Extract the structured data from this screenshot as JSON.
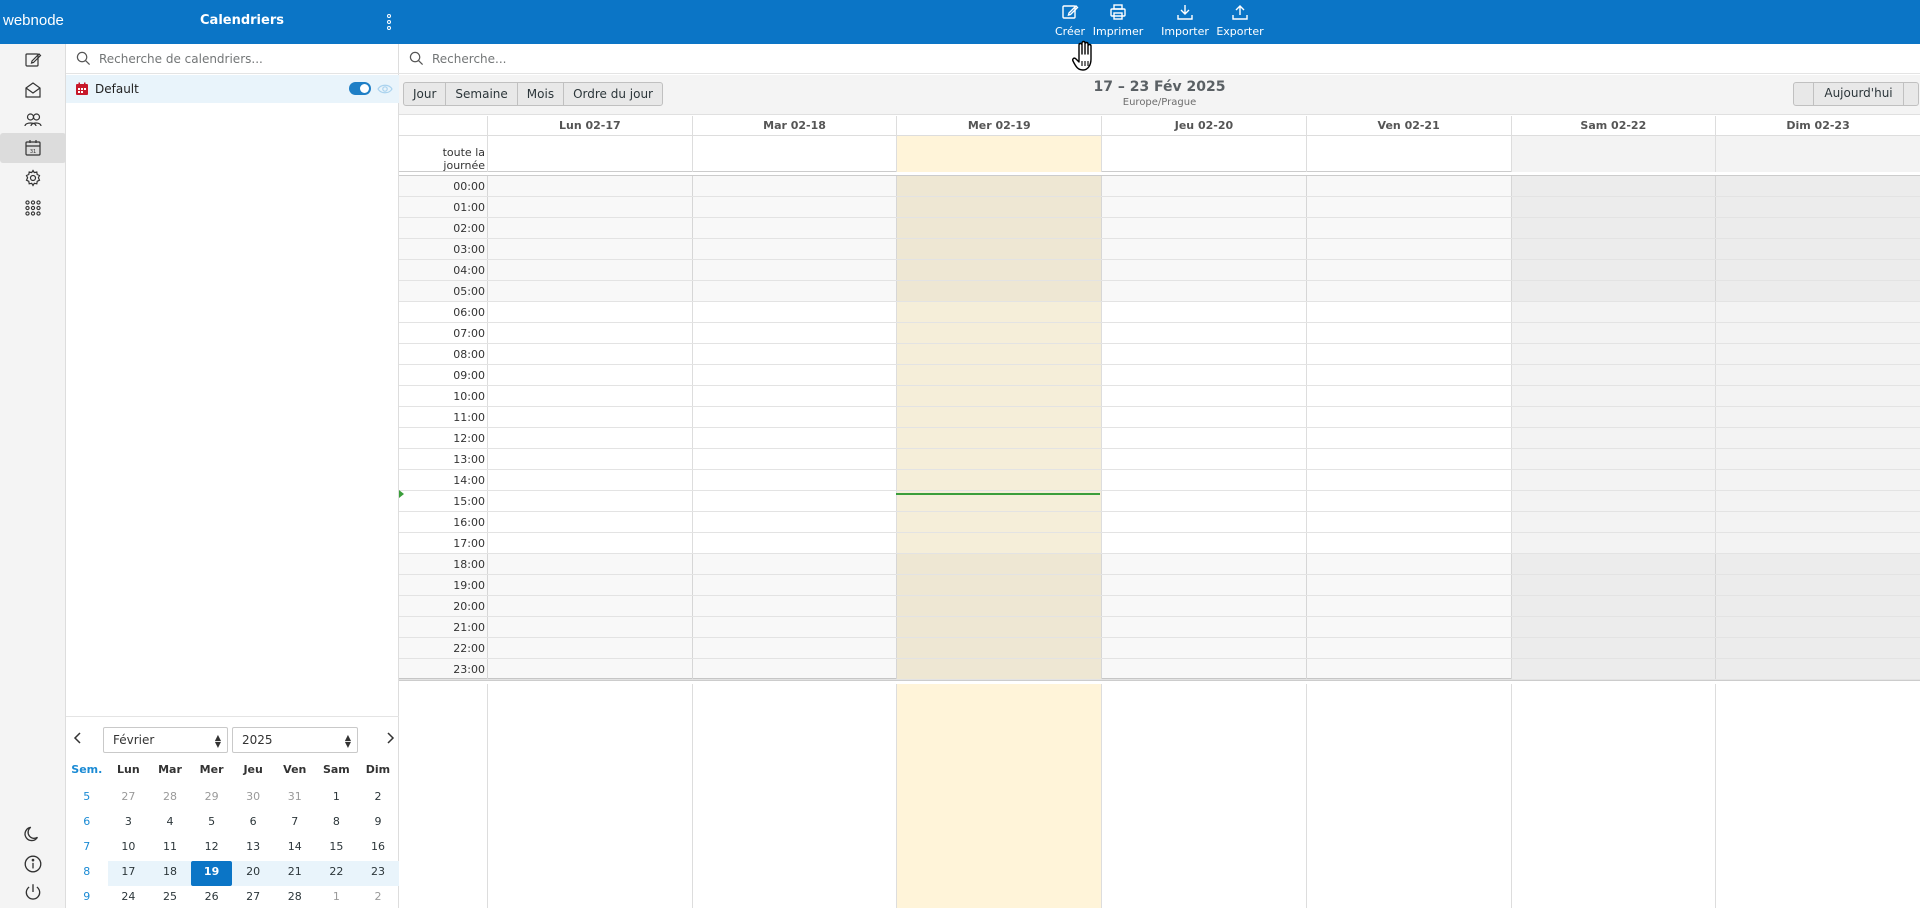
{
  "app": {
    "logo": "webnode",
    "panel_title": "Calendriers"
  },
  "toolbar": {
    "create": "Créer",
    "print": "Imprimer",
    "import": "Importer",
    "export": "Exporter"
  },
  "sidebar": {
    "search_placeholder": "Recherche de calendriers...",
    "calendars": [
      {
        "name": "Default",
        "enabled": true,
        "color": "#c7192b"
      }
    ]
  },
  "mini_calendar": {
    "month": "Février",
    "year": "2025",
    "headers": [
      "Sem.",
      "Lun",
      "Mar",
      "Mer",
      "Jeu",
      "Ven",
      "Sam",
      "Dim"
    ],
    "weeks": [
      [
        "5",
        "27",
        "28",
        "29",
        "30",
        "31",
        "1",
        "2"
      ],
      [
        "6",
        "3",
        "4",
        "5",
        "6",
        "7",
        "8",
        "9"
      ],
      [
        "7",
        "10",
        "11",
        "12",
        "13",
        "14",
        "15",
        "16"
      ],
      [
        "8",
        "17",
        "18",
        "19",
        "20",
        "21",
        "22",
        "23"
      ],
      [
        "9",
        "24",
        "25",
        "26",
        "27",
        "28",
        "1",
        "2"
      ]
    ],
    "today": "19"
  },
  "main": {
    "search_placeholder": "Recherche...",
    "views": [
      "Jour",
      "Semaine",
      "Mois",
      "Ordre du jour"
    ],
    "range_title": "17 – 23 Fév 2025",
    "timezone": "Europe/Prague",
    "today_button": "Aujourd'hui",
    "all_day_label": "toute la journée",
    "days": [
      "Lun 02-17",
      "Mar 02-18",
      "Mer 02-19",
      "Jeu 02-20",
      "Ven 02-21",
      "Sam 02-22",
      "Dim 02-23"
    ],
    "hours": [
      "00:00",
      "01:00",
      "02:00",
      "03:00",
      "04:00",
      "05:00",
      "06:00",
      "07:00",
      "08:00",
      "09:00",
      "10:00",
      "11:00",
      "12:00",
      "13:00",
      "14:00",
      "15:00",
      "16:00",
      "17:00",
      "18:00",
      "19:00",
      "20:00",
      "21:00",
      "22:00",
      "23:00"
    ],
    "current_time": "15:06"
  },
  "colors": {
    "topbar": "#0b75c6",
    "today_column": "#fff4d9",
    "weekend": "#f3f3f3",
    "now_line": "#3b9e3b"
  }
}
